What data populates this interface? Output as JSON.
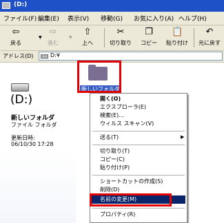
{
  "window": {
    "title": "(D:)"
  },
  "menubar": {
    "items": [
      "ファイル(F)",
      "編集(E)",
      "表示(V)",
      "移動(G)",
      "お気に入り(A)",
      "ヘルプ(H)"
    ]
  },
  "toolbar": {
    "back": "戻る",
    "forward": "進む",
    "up": "上へ",
    "cut": "切り取り",
    "copy": "コピー",
    "paste": "貼り付け",
    "undo": "元に戻す"
  },
  "address": {
    "label": "アドレス(D)",
    "value": "D:¥"
  },
  "panel": {
    "drive_label": "(D:)",
    "item_name": "新しいフォルダ",
    "item_type": "ファイル フォルダ",
    "modified_label": "更新日時:",
    "modified_date": "06/10/30 17:28"
  },
  "folder": {
    "label": "新しいフォルダ"
  },
  "context_menu": {
    "items": [
      "開く(O)",
      "エクスプローラ(E)",
      "検索(E)...",
      "ウィルス スキャン(V)",
      "送る(T)",
      "切り取り(T)",
      "コピー(C)",
      "貼り付け(P)",
      "ショートカットの作成(S)",
      "削除(D)",
      "名前の変更(M)",
      "プロパティ(R)"
    ],
    "highlighted": "名前の変更(M)"
  },
  "colors": {
    "title_bar": "#1e50c8",
    "highlight": "#0a246a",
    "callout": "#e30000"
  }
}
